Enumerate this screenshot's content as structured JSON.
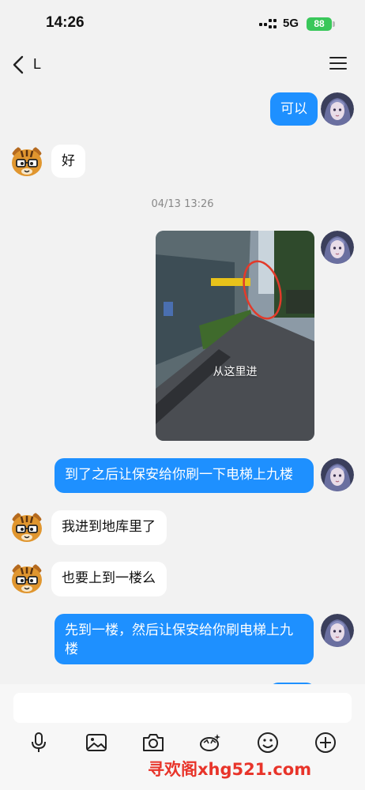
{
  "status_bar": {
    "time": "14:26",
    "network": "5G",
    "battery": "88"
  },
  "header": {
    "title": "L",
    "back_icon": "chevron-left-icon",
    "menu_icon": "hamburger-menu-icon"
  },
  "messages": [
    {
      "direction": "out",
      "type": "text",
      "text": "可以"
    },
    {
      "direction": "in",
      "type": "text",
      "text": "好"
    },
    {
      "type": "timestamp",
      "text": "04/13 13:26"
    },
    {
      "direction": "out",
      "type": "image",
      "caption": "从这里进"
    },
    {
      "direction": "out",
      "type": "text",
      "text": "到了之后让保安给你刷一下电梯上九楼"
    },
    {
      "direction": "in",
      "type": "text",
      "text": "我进到地库里了"
    },
    {
      "direction": "in",
      "type": "text",
      "text": "也要上到一楼么"
    },
    {
      "direction": "out",
      "type": "text",
      "text": "先到一楼，然后让保安给你刷电梯上九楼"
    }
  ],
  "input": {
    "placeholder": ""
  },
  "toolbar": [
    "microphone-icon",
    "image-icon",
    "camera-icon",
    "sticker-icon",
    "emoji-icon",
    "plus-icon"
  ],
  "watermark": "寻欢阁xhg521.com",
  "colors": {
    "outgoing_bubble": "#1e90ff",
    "incoming_bubble": "#ffffff",
    "background": "#f2f2f2",
    "battery": "#39c75a",
    "watermark": "#e8342a"
  }
}
